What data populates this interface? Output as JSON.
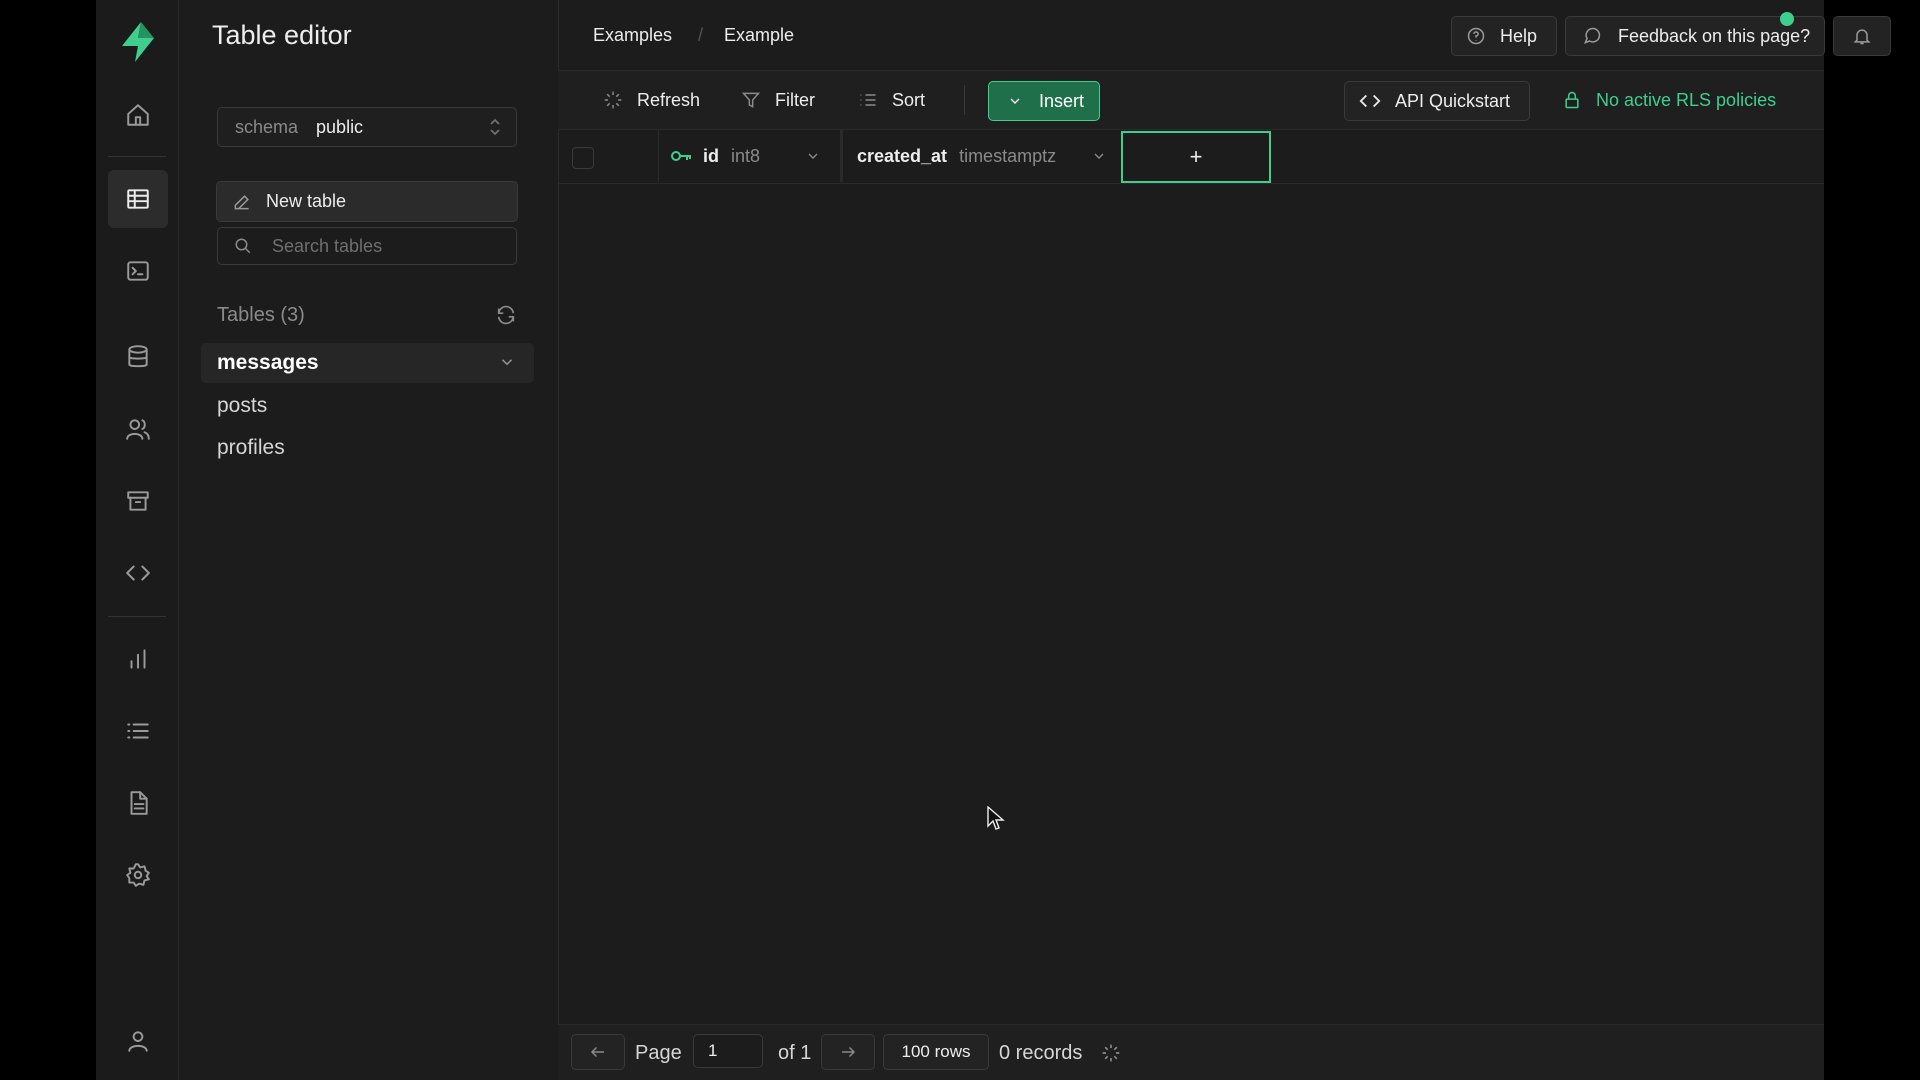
{
  "app": {
    "title": "Table editor",
    "accent_color": "#3ecf8e"
  },
  "breadcrumb": [
    "Examples",
    "Example"
  ],
  "topbar": {
    "help_label": "Help",
    "feedback_label": "Feedback on this page?"
  },
  "rail": {
    "icons": [
      "home-icon",
      "table-editor-icon",
      "sql-editor-icon",
      "database-icon",
      "auth-users-icon",
      "storage-icon",
      "api-code-icon",
      "reports-icon",
      "logs-icon",
      "docs-icon",
      "settings-icon",
      "profile-icon"
    ]
  },
  "sidebar": {
    "schema_label": "schema",
    "schema_value": "public",
    "new_table_label": "New table",
    "search_placeholder": "Search tables",
    "tables_header": "Tables (3)",
    "tables": [
      {
        "name": "messages",
        "active": true
      },
      {
        "name": "posts",
        "active": false
      },
      {
        "name": "profiles",
        "active": false
      }
    ]
  },
  "toolbar": {
    "refresh_label": "Refresh",
    "filter_label": "Filter",
    "sort_label": "Sort",
    "insert_label": "Insert",
    "api_label": "API Quickstart",
    "rls_label": "No active RLS policies"
  },
  "grid": {
    "columns": [
      {
        "name": "id",
        "type": "int8",
        "primary_key": true
      },
      {
        "name": "created_at",
        "type": "timestamptz",
        "primary_key": false
      }
    ],
    "add_column_label": "+"
  },
  "footer": {
    "page_label": "Page",
    "page_value": "1",
    "of_label": "of 1",
    "rows_label": "100 rows",
    "records_label": "0 records"
  }
}
